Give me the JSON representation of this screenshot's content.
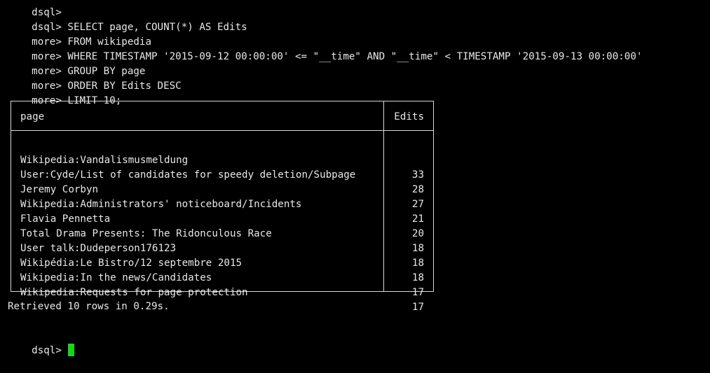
{
  "colors": {
    "background": "#000000",
    "text": "#e8e8e8",
    "border": "#d8d8d8",
    "cursor": "#1ad41a"
  },
  "session": {
    "top_partial_prompt": "dsql>",
    "lines": [
      {
        "prompt": "dsql> ",
        "text": "SELECT page, COUNT(*) AS Edits"
      },
      {
        "prompt": "more> ",
        "text": "FROM wikipedia"
      },
      {
        "prompt": "more> ",
        "text": "WHERE TIMESTAMP '2015-09-12 00:00:00' <= \"__time\" AND \"__time\" < TIMESTAMP '2015-09-13 00:00:00'"
      },
      {
        "prompt": "more> ",
        "text": "GROUP BY page"
      },
      {
        "prompt": "more> ",
        "text": "ORDER BY Edits DESC"
      },
      {
        "prompt": "more> ",
        "text": "LIMIT 10;"
      }
    ]
  },
  "table": {
    "columns": [
      "page",
      "Edits"
    ],
    "rows": [
      {
        "page": "Wikipedia:Vandalismusmeldung",
        "edits": "33"
      },
      {
        "page": "User:Cyde/List of candidates for speedy deletion/Subpage",
        "edits": "28"
      },
      {
        "page": "Jeremy Corbyn",
        "edits": "27"
      },
      {
        "page": "Wikipedia:Administrators' noticeboard/Incidents",
        "edits": "21"
      },
      {
        "page": "Flavia Pennetta",
        "edits": "20"
      },
      {
        "page": "Total Drama Presents: The Ridonculous Race",
        "edits": "18"
      },
      {
        "page": "User talk:Dudeperson176123",
        "edits": "18"
      },
      {
        "page": "Wikipédia:Le Bistro/12 septembre 2015",
        "edits": "18"
      },
      {
        "page": "Wikipedia:In the news/Candidates",
        "edits": "17"
      },
      {
        "page": "Wikipedia:Requests for page protection",
        "edits": "17"
      }
    ]
  },
  "status": {
    "message": "Retrieved 10 rows in 0.29s."
  },
  "current_prompt": {
    "prompt": "dsql> ",
    "input": ""
  }
}
